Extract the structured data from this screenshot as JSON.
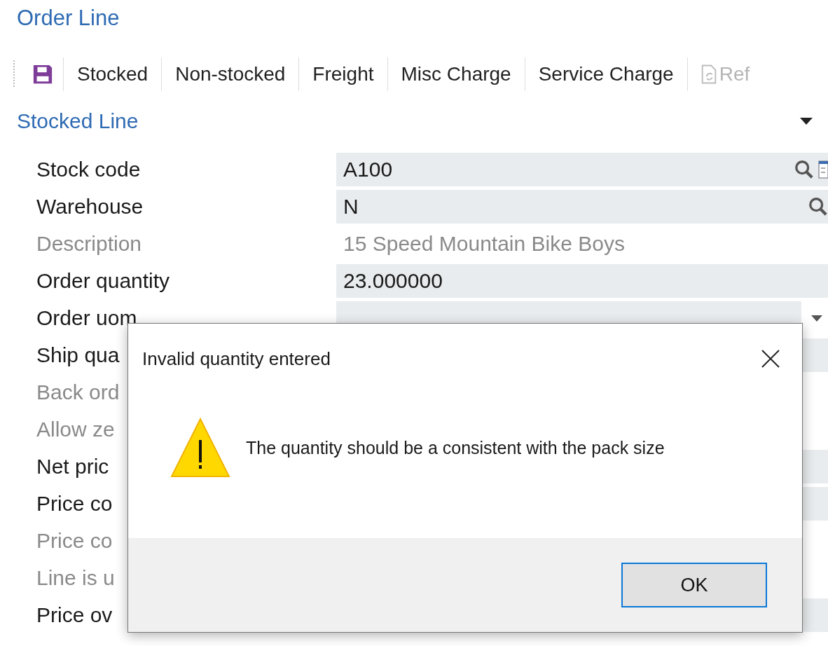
{
  "page": {
    "title": "Order Line"
  },
  "toolbar": {
    "items": [
      {
        "kind": "save",
        "disabled": false
      },
      {
        "kind": "text",
        "label": "Stocked",
        "disabled": false
      },
      {
        "kind": "text",
        "label": "Non-stocked",
        "disabled": false
      },
      {
        "kind": "text",
        "label": "Freight",
        "disabled": false
      },
      {
        "kind": "text",
        "label": "Misc Charge",
        "disabled": false
      },
      {
        "kind": "text",
        "label": "Service Charge",
        "disabled": false
      },
      {
        "kind": "refresh",
        "label": "Ref",
        "disabled": true
      }
    ]
  },
  "section": {
    "title": "Stocked Line",
    "expanded": true
  },
  "fields": [
    {
      "label": "Stock code",
      "value": "A100",
      "kind": "lookup-list",
      "disabled": false
    },
    {
      "label": "Warehouse",
      "value": "N",
      "kind": "lookup",
      "disabled": false
    },
    {
      "label": "Description",
      "value": "15 Speed Mountain Bike Boys",
      "kind": "readonly",
      "disabled": true
    },
    {
      "label": "Order quantity",
      "value": "23.000000",
      "kind": "text",
      "disabled": false
    },
    {
      "label": "Order uom",
      "kind": "dropdown",
      "disabled": false
    },
    {
      "label": "Ship qua",
      "kind": "text",
      "disabled": false
    },
    {
      "label": "Back ord",
      "kind": "readonly",
      "disabled": true
    },
    {
      "label": "Allow ze",
      "kind": "readonly",
      "disabled": true
    },
    {
      "label": "Net pric",
      "kind": "text",
      "disabled": false
    },
    {
      "label": "Price co",
      "kind": "text",
      "disabled": false
    },
    {
      "label": "Price co",
      "kind": "readonly",
      "disabled": true
    },
    {
      "label": "Line is u",
      "kind": "readonly",
      "disabled": true
    },
    {
      "label": "Price ov",
      "kind": "text",
      "disabled": false
    }
  ],
  "dialog": {
    "title": "Invalid quantity entered",
    "message": "The quantity should be a consistent with the pack size",
    "buttons": [
      "OK"
    ]
  }
}
